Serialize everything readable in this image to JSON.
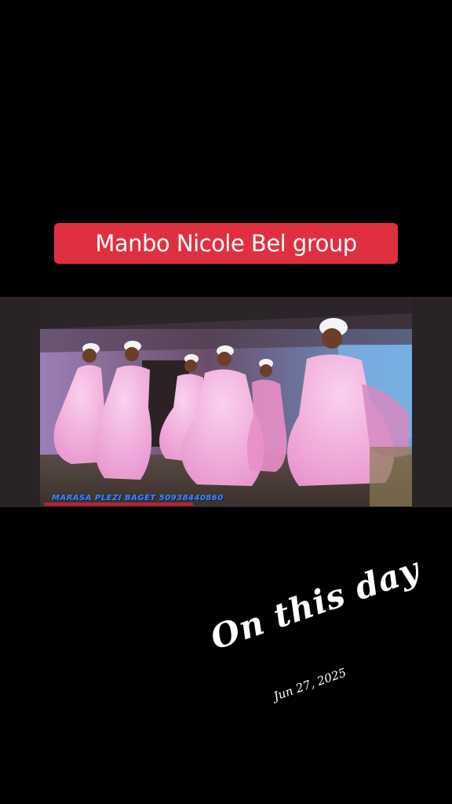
{
  "caption": {
    "text": "Manbo Nicole Bel group"
  },
  "video": {
    "watermark": "MARASA PLEZI BAGÈT 50938440860"
  },
  "memory": {
    "title": "On this day",
    "date": "Jun 27, 2025"
  },
  "colors": {
    "banner": "#e0303f",
    "background": "#000000",
    "dress": "#f2a9d8"
  }
}
